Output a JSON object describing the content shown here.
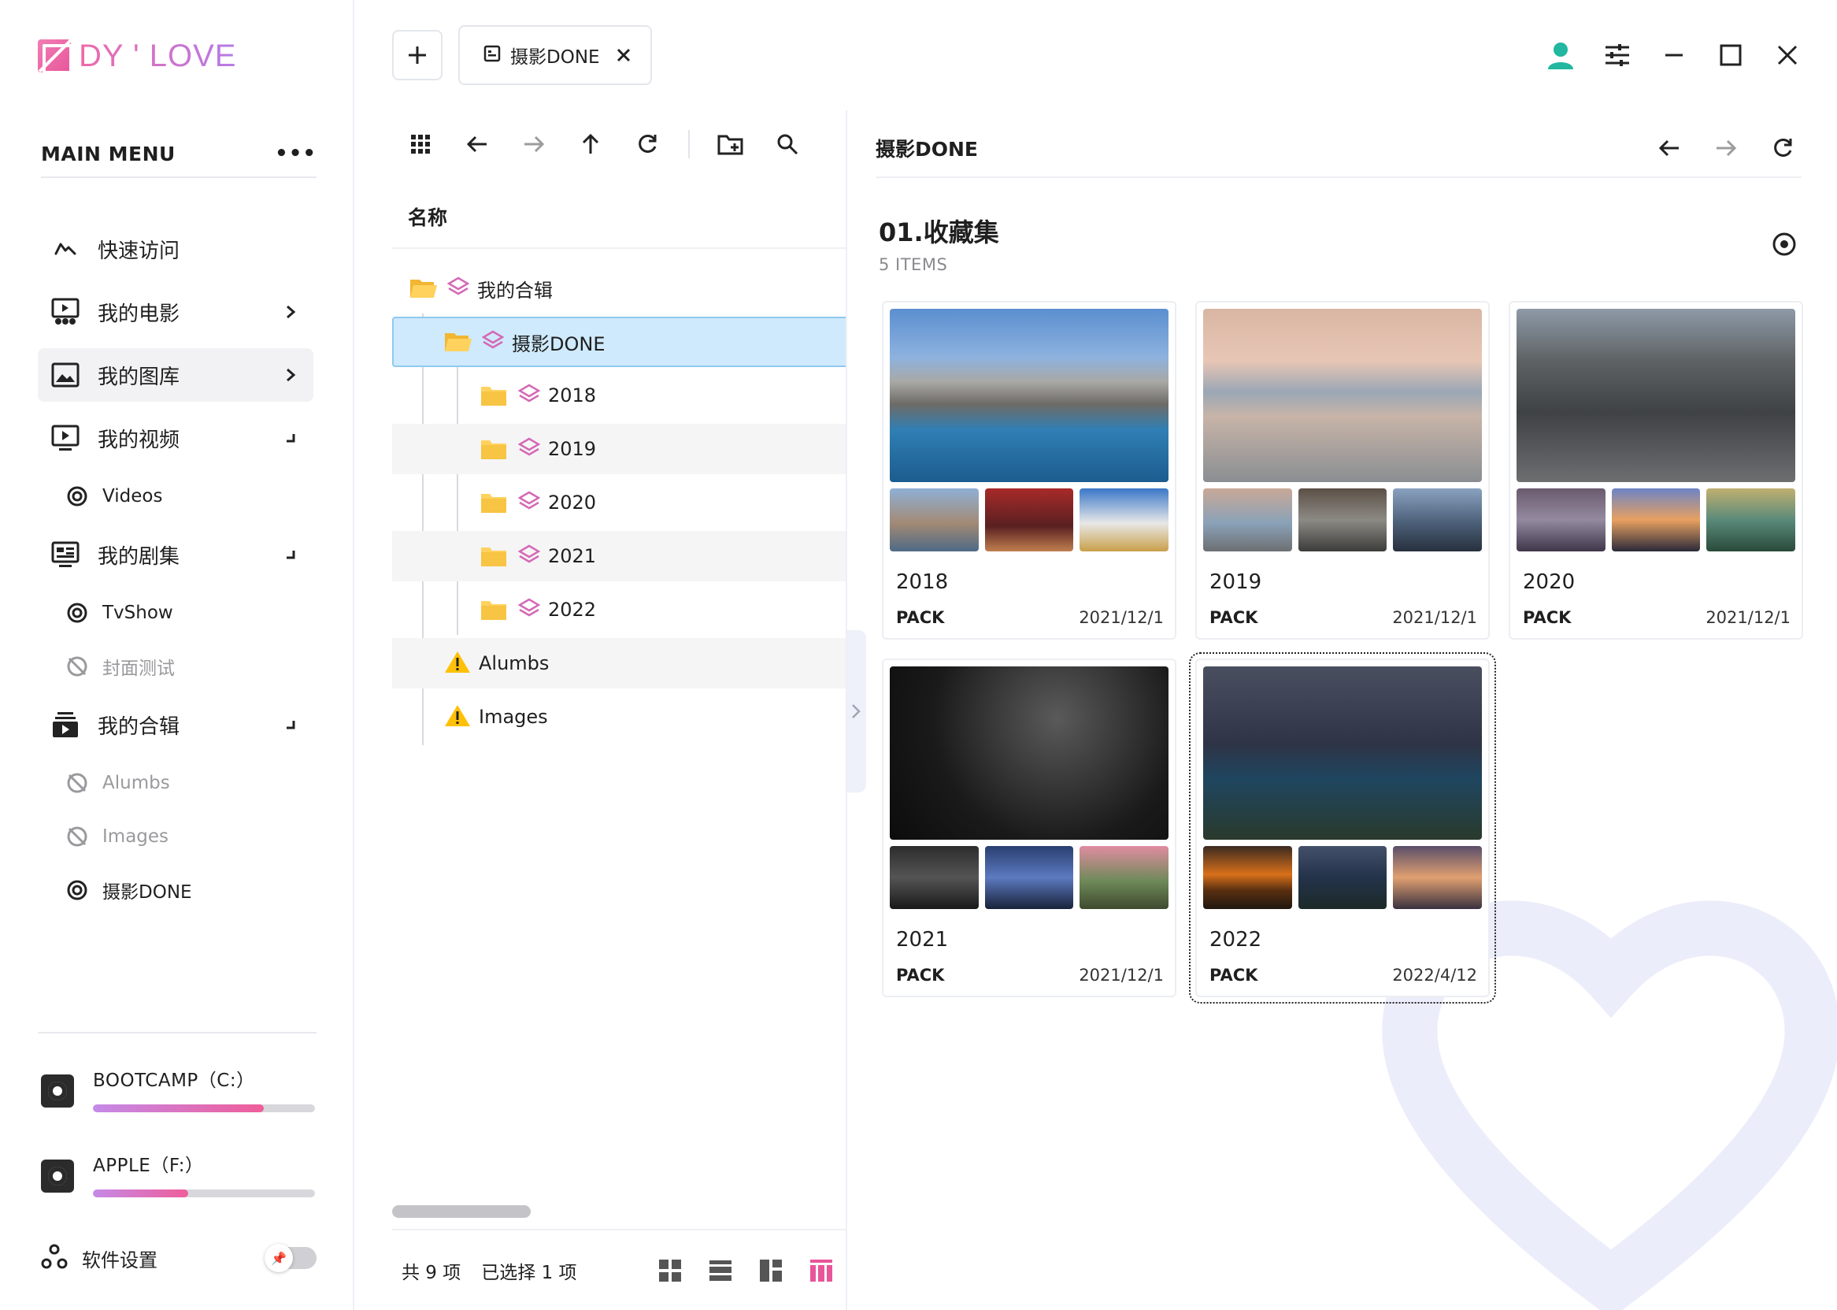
{
  "app": {
    "logo_text": "DY ' LOVE",
    "brand_colors": [
      "#ef6aa8",
      "#b57be8"
    ]
  },
  "tabs": [
    {
      "label": "摄影DONE"
    }
  ],
  "sidebar": {
    "menu_title": "MAIN MENU",
    "more_icon": "more-horizontal-icon",
    "items": [
      {
        "label": "快速访问",
        "icon": "quick-access-icon"
      },
      {
        "label": "我的电影",
        "icon": "movie-icon",
        "arrow": "chevron-right"
      },
      {
        "label": "我的图库",
        "icon": "image-gallery-icon",
        "arrow": "chevron-right",
        "active": true
      },
      {
        "label": "我的视频",
        "icon": "video-icon",
        "arrow": "collapse"
      },
      {
        "label": "我的剧集",
        "icon": "tv-series-icon",
        "arrow": "collapse"
      },
      {
        "label": "我的合辑",
        "icon": "collection-icon",
        "arrow": "collapse"
      }
    ],
    "subitems": {
      "videos": [
        {
          "label": "Videos",
          "state": "active"
        }
      ],
      "series": [
        {
          "label": "TvShow",
          "state": "active"
        },
        {
          "label": "封面测试",
          "state": "disabled"
        }
      ],
      "collections": [
        {
          "label": "Alumbs",
          "state": "disabled"
        },
        {
          "label": "Images",
          "state": "disabled"
        },
        {
          "label": "摄影DONE",
          "state": "active"
        }
      ]
    },
    "disks": [
      {
        "name": "BOOTCAMP（C:）",
        "usage": 0.77
      },
      {
        "name": "APPLE（F:）",
        "usage": 0.43
      }
    ],
    "settings_label": "软件设置",
    "settings_toggle": "off"
  },
  "tree": {
    "column_header": "名称",
    "rows": [
      {
        "label": "我的合辑",
        "level": 0,
        "type": "collection-open"
      },
      {
        "label": "摄影DONE",
        "level": 1,
        "type": "collection-open",
        "selected": true
      },
      {
        "label": "2018",
        "level": 2,
        "type": "collection"
      },
      {
        "label": "2019",
        "level": 2,
        "type": "collection"
      },
      {
        "label": "2020",
        "level": 2,
        "type": "collection"
      },
      {
        "label": "2021",
        "level": 2,
        "type": "collection"
      },
      {
        "label": "2022",
        "level": 2,
        "type": "collection"
      },
      {
        "label": "Alumbs",
        "level": 1,
        "type": "warning"
      },
      {
        "label": "Images",
        "level": 1,
        "type": "warning"
      }
    ],
    "status": {
      "total": "共 9 项",
      "selected": "已选择 1 项"
    }
  },
  "content": {
    "breadcrumb_title": "摄影DONE",
    "section_title": "01.收藏集",
    "section_count": "5 ITEMS",
    "cards": [
      {
        "name": "2018",
        "kind": "PACK",
        "date": "2021/12/1"
      },
      {
        "name": "2019",
        "kind": "PACK",
        "date": "2021/12/1"
      },
      {
        "name": "2020",
        "kind": "PACK",
        "date": "2021/12/1"
      },
      {
        "name": "2021",
        "kind": "PACK",
        "date": "2021/12/1"
      },
      {
        "name": "2022",
        "kind": "PACK",
        "date": "2022/4/12",
        "focused": true
      }
    ]
  }
}
